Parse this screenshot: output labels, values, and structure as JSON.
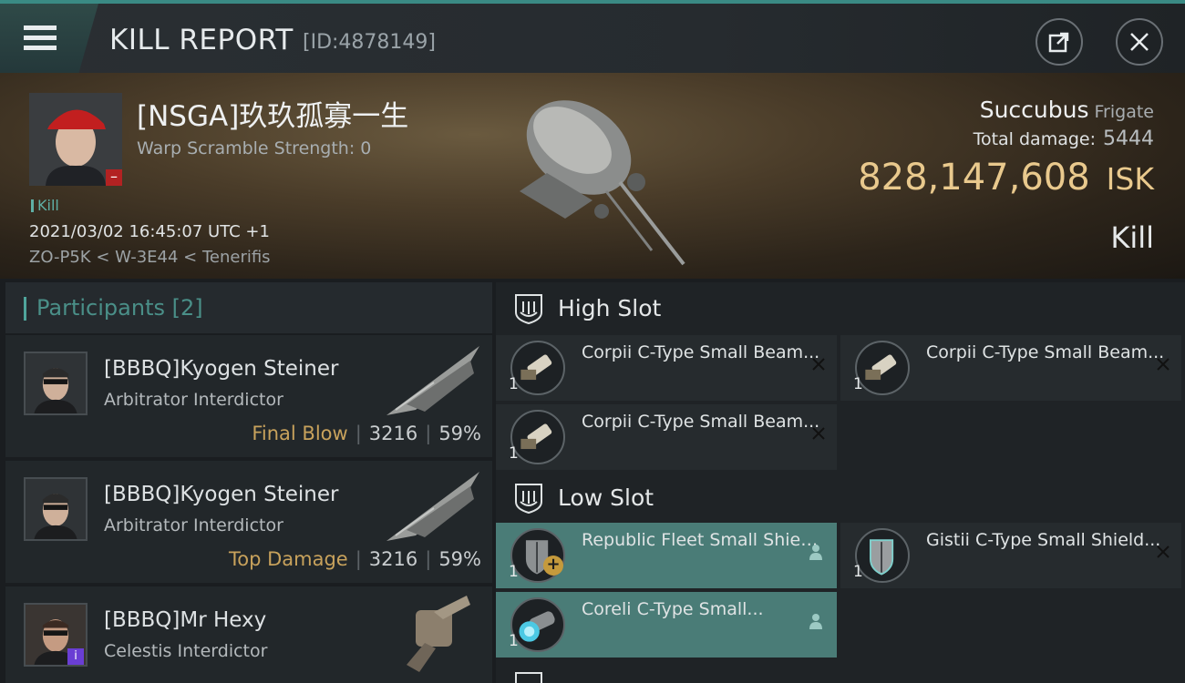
{
  "header": {
    "title": "KILL REPORT",
    "id_text": "[ID:4878149]"
  },
  "victim": {
    "name": "[NSGA]玖玖孤寡一生",
    "warp_scramble": "Warp Scramble Strength: 0",
    "kill_tag": "Kill",
    "timestamp": "2021/03/02 16:45:07 UTC +1",
    "location": "ZO-P5K < W-3E44 < Tenerifis",
    "ship_name": "Succubus",
    "ship_class": "Frigate",
    "total_damage_label": "Total damage:",
    "total_damage_value": "5444",
    "isk_amount": "828,147,608",
    "isk_unit": "ISK",
    "kill_type": "Kill"
  },
  "participants": {
    "label": "Participants",
    "count": "[2]",
    "items": [
      {
        "name": "[BBBQ]Kyogen Steiner",
        "ship": "Arbitrator Interdictor",
        "tag": "Final Blow",
        "damage": "3216",
        "percent": "59%"
      },
      {
        "name": "[BBBQ]Kyogen Steiner",
        "ship": "Arbitrator Interdictor",
        "tag": "Top Damage",
        "damage": "3216",
        "percent": "59%"
      },
      {
        "name": "[BBBQ]Mr Hexy",
        "ship": "Celestis Interdictor"
      }
    ]
  },
  "slots": {
    "high": {
      "label": "High Slot",
      "items": [
        {
          "name": "Corpii C-Type Small Beam...",
          "qty": "1"
        },
        {
          "name": "Corpii C-Type Small Beam...",
          "qty": "1"
        },
        {
          "name": "Corpii C-Type Small Beam...",
          "qty": "1"
        }
      ]
    },
    "low": {
      "label": "Low Slot",
      "items": [
        {
          "name": "Republic Fleet Small Shield...",
          "qty": "1"
        },
        {
          "name": "Gistii C-Type Small Shield...",
          "qty": "1"
        },
        {
          "name": "Coreli C-Type Small...",
          "qty": "1"
        }
      ]
    }
  },
  "colors": {
    "accent": "#4fa59c",
    "isk": "#e9c98d",
    "final_blow": "#c8a25c",
    "fitted_item": "#4a7c77"
  }
}
